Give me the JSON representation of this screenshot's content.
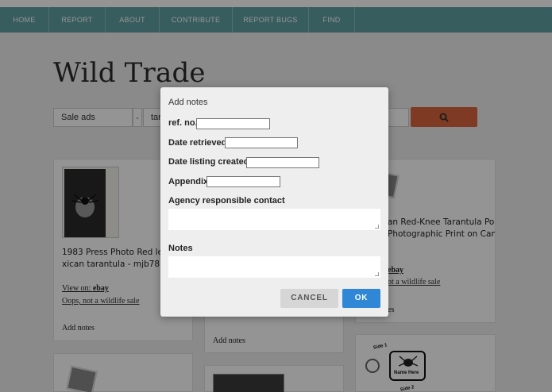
{
  "nav": {
    "items": [
      "HOME",
      "REPORT",
      "ABOUT",
      "CONTRIBUTE",
      "REPORT BUGS",
      "FIND"
    ]
  },
  "site": {
    "title": "Wild Trade"
  },
  "search": {
    "type_value": "Sale ads",
    "query_value": "tara"
  },
  "cards": [
    {
      "title_line1": "1983 Press Photo Red legg",
      "title_line2": "xican tarantula - mjb78787",
      "view_on_prefix": "View on: ",
      "view_on_site": "ebay",
      "oops": "Oops, not a wildlife sale",
      "add_notes": "Add notes"
    },
    {
      "add_notes": "Add notes"
    },
    {
      "title_line1": "an Red-Knee Tarantula Po",
      "title_line2": "Photographic Print on Can",
      "view_on_site": "ebay",
      "oops": "ot a wildlife sale",
      "add_notes": "es"
    }
  ],
  "keychain": {
    "side1": "Side 1",
    "name_here": "Name Here",
    "side2": "Side 2"
  },
  "modal": {
    "title": "Add notes",
    "ref_label": "ref. no.",
    "date_retrieved_label": "Date retrieved",
    "date_listing_label": "Date listing created",
    "appendix_label": "Appendix",
    "agency_label": "Agency responsible contact",
    "notes_label": "Notes",
    "cancel_label": "CANCEL",
    "ok_label": "OK"
  },
  "colors": {
    "nav_bg": "#5fa0a4",
    "search_button": "#d9653b",
    "ok_button": "#2f87d6"
  }
}
